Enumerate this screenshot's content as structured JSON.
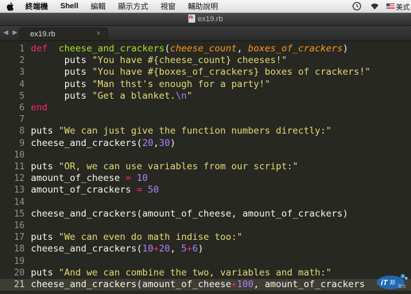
{
  "menubar": {
    "items": [
      "終端機",
      "Shell",
      "編輯",
      "顯示方式",
      "視窗",
      "輔助說明"
    ],
    "input_source": "美式"
  },
  "window": {
    "title": "ex19.rb"
  },
  "tabs": [
    {
      "label": "ex19.rb",
      "close": "×"
    }
  ],
  "tab_nav": "◀ ▶",
  "editor": {
    "current_line": 21,
    "lines": [
      {
        "n": "1",
        "tokens": [
          [
            "kw",
            "def"
          ],
          [
            "",
            "  "
          ],
          [
            "fn",
            "cheese_and_crackers"
          ],
          [
            "",
            "("
          ],
          [
            "param",
            "cheese_count"
          ],
          [
            "",
            ", "
          ],
          [
            "param",
            "boxes_of_crackers"
          ],
          [
            "",
            ")"
          ]
        ]
      },
      {
        "n": "2",
        "tokens": [
          [
            "",
            "      puts "
          ],
          [
            "str",
            "\"You have #{cheese_count} cheeses!\""
          ]
        ]
      },
      {
        "n": "3",
        "tokens": [
          [
            "",
            "      puts "
          ],
          [
            "str",
            "\"You have #{boxes_of_crackers} boxes of crackers!\""
          ]
        ]
      },
      {
        "n": "4",
        "tokens": [
          [
            "",
            "      puts "
          ],
          [
            "str",
            "\"Man thst's enough for a party!\""
          ]
        ]
      },
      {
        "n": "5",
        "tokens": [
          [
            "",
            "      puts "
          ],
          [
            "str",
            "\"Get a blanket."
          ],
          [
            "esc",
            "\\n"
          ],
          [
            "str",
            "\""
          ]
        ]
      },
      {
        "n": "6",
        "tokens": [
          [
            "kw",
            "end"
          ]
        ]
      },
      {
        "n": "7",
        "tokens": []
      },
      {
        "n": "8",
        "tokens": [
          [
            "",
            "puts "
          ],
          [
            "str",
            "\"We can just give the function numbers directly:\""
          ]
        ]
      },
      {
        "n": "9",
        "tokens": [
          [
            "",
            "cheese_and_crackers("
          ],
          [
            "num",
            "20"
          ],
          [
            "",
            ","
          ],
          [
            "num",
            "30"
          ],
          [
            "",
            ")"
          ]
        ]
      },
      {
        "n": "10",
        "tokens": []
      },
      {
        "n": "11",
        "tokens": [
          [
            "",
            "puts "
          ],
          [
            "str",
            "\"OR, we can use variables from our script:\""
          ]
        ]
      },
      {
        "n": "12",
        "tokens": [
          [
            "",
            "amount_of_cheese "
          ],
          [
            "op",
            "="
          ],
          [
            "num",
            " 10"
          ]
        ]
      },
      {
        "n": "13",
        "tokens": [
          [
            "",
            "amount_of_crackers "
          ],
          [
            "op",
            "="
          ],
          [
            "num",
            " 50"
          ]
        ]
      },
      {
        "n": "14",
        "tokens": []
      },
      {
        "n": "15",
        "tokens": [
          [
            "",
            "cheese_and_crackers(amount_of_cheese, amount_of_crackers)"
          ]
        ]
      },
      {
        "n": "16",
        "tokens": []
      },
      {
        "n": "17",
        "tokens": [
          [
            "",
            "puts "
          ],
          [
            "str",
            "\"We can even do math indise too:\""
          ]
        ]
      },
      {
        "n": "18",
        "tokens": [
          [
            "",
            "cheese_and_crackers("
          ],
          [
            "num",
            "10"
          ],
          [
            "op",
            "+"
          ],
          [
            "num",
            "20"
          ],
          [
            "",
            ", "
          ],
          [
            "num",
            "5"
          ],
          [
            "op",
            "+"
          ],
          [
            "num",
            "6"
          ],
          [
            "",
            ")"
          ]
        ]
      },
      {
        "n": "19",
        "tokens": []
      },
      {
        "n": "20",
        "tokens": [
          [
            "",
            "puts "
          ],
          [
            "str",
            "\"And we can combine the two, variables and math:\""
          ]
        ]
      },
      {
        "n": "21",
        "tokens": [
          [
            "",
            "cheese_and_crackers(amount_of_cheese"
          ],
          [
            "op",
            "+"
          ],
          [
            "num",
            "100"
          ],
          [
            "",
            ", amount_of_crackers"
          ]
        ]
      }
    ]
  },
  "watermark": {
    "text": "iThome",
    "sub": "鐵人"
  },
  "colors": {
    "background": "#272822",
    "keyword": "#f92672",
    "function": "#a6e22e",
    "parameter": "#fd971f",
    "string": "#e6db74",
    "number": "#ae81ff"
  },
  "icons": {
    "apple": "apple-icon",
    "time_machine": "time-machine-icon",
    "wifi": "wifi-icon",
    "flag": "us-flag-icon"
  }
}
